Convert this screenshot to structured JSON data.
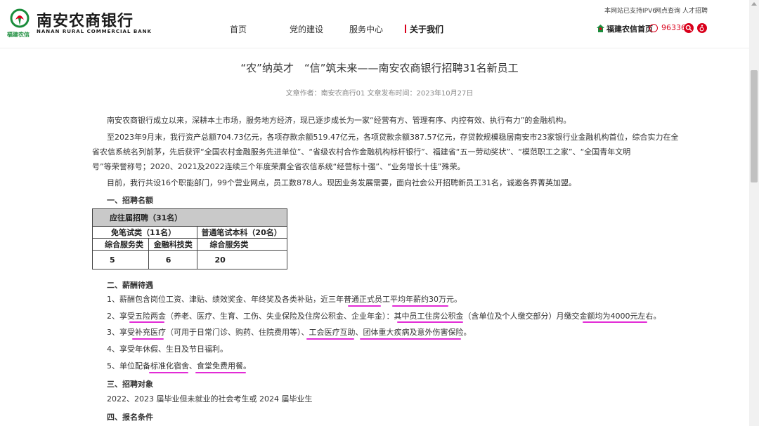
{
  "header": {
    "logo": {
      "name": "南安农商银行",
      "en": "NANAN RURAL COMMERCIAL BANK",
      "sub": "福建农信"
    },
    "nav": [
      "首页",
      "党的建设",
      "服务中心",
      "关于我们"
    ],
    "toplinks": [
      "本网站已支持IPV6",
      "网点查询",
      "人才招聘"
    ],
    "home_link": "福建农信首页",
    "phone": "96336",
    "colors": {
      "accent": "#d9001b",
      "brand": "#1a8c3b",
      "highlight": "#e22bd6"
    },
    "icons": [
      "fujian-rural-credit-logo-icon",
      "home-leaf-icon",
      "phone-icon",
      "search-icon",
      "accessibility-icon"
    ]
  },
  "article": {
    "title": "“农”纳英才　“信”筑未来——南安农商银行招聘31名新员工",
    "meta": "文章作者：南安农商行01  文章发布时间：2023年10月27日",
    "para1": "南安农商银行成立以来，深耕本土市场，服务地方经济，现已逐步成长为一家“经营有方、管理有序、内控有效、执行有力”的金融机构。",
    "para2_l1": "至2023年9月末，我行资产总额704.73亿元，各项存款余额519.47亿元，各项贷款余额387.57亿元，存贷款规模稳居南安市23家银行业金融机构首位，综合实力在全",
    "para2_l2": "省农信系统名列前茅，先后获评“全国农村金融服务先进单位”、“省级农村合作金融机构标杆银行”、福建省“五一劳动奖状”、“模范职工之家”、“全国青年文明",
    "para2_l3": "号”等荣誉称号；2020、2021及2022连续三个年度荣膺全省农信系统“经营标十强”、“业务增长十佳”殊荣。",
    "para3": "目前，我行共设16个职能部门，99个营业网点，员工数878人。现因业务发展需要，面向社会公开招聘新员工31名，诚邀各界菁英加盟。",
    "sec1": "一、招聘名额",
    "table": {
      "header": "应往届招聘（31名）",
      "group1": "免笔试类（11名）",
      "group2": "普通笔试本科（20名）",
      "sub1": "综合服务类",
      "sub2": "金融科技类",
      "sub3": "综合服务类",
      "v1": "5",
      "v2": "6",
      "v3": "20"
    },
    "sec2": "二、薪酬待遇",
    "benefits": [
      "1、薪酬包含岗位工资、津贴、绩效奖金、年终奖及各类补贴，近三年普通正式员工平均年薪约30万元。",
      "2、享受五险两金（养老、医疗、生育、工伤、失业保险及住房公积金、企业年金）：其中员工住房公积金（含单位及个人缴交部分）月缴交金额均为4000元左右。",
      "3、享受补充医疗（可用于日常门诊、购药、住院费用等）、工会医疗互助、团体重大疾病及意外伤害保险。",
      "4、享受年休假、生日及节日福利。",
      "5、单位配备标准化宿舍、食堂免费用餐。"
    ],
    "sec3": "三、招聘对象",
    "target": "2022、2023 届毕业但未就业的社会考生或 2024 届毕业生",
    "sec4": "四、报名条件"
  }
}
